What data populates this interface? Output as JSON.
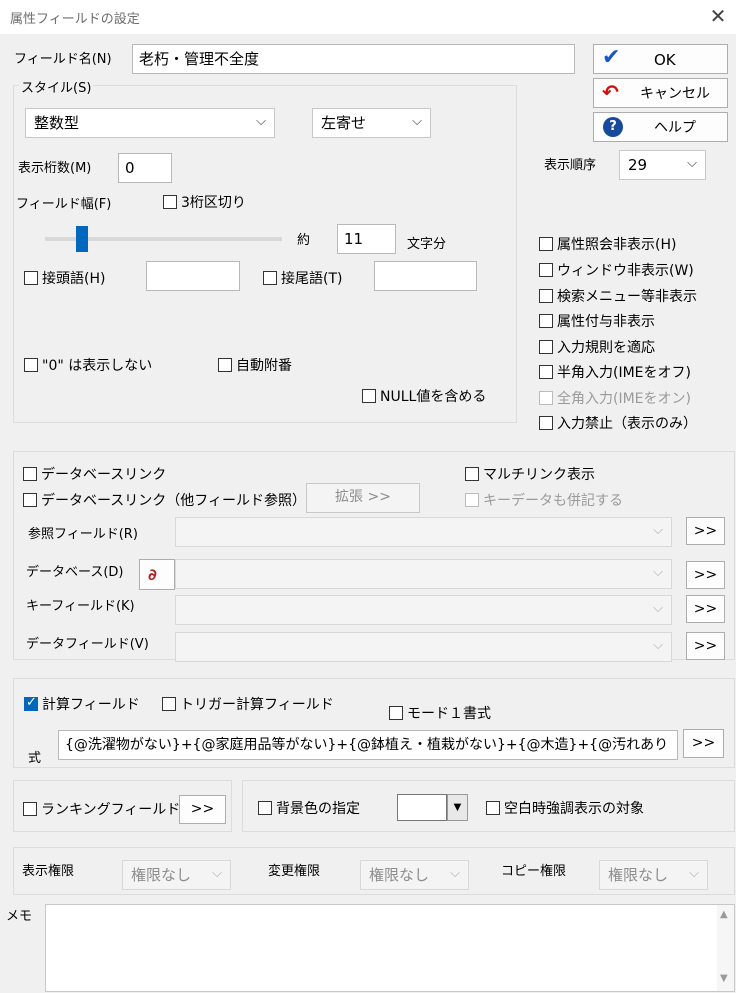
{
  "window": {
    "title": "属性フィールドの設定",
    "close_glyph": "✕"
  },
  "field_name": {
    "label": "フィールド名(N)",
    "value": "老朽・管理不全度"
  },
  "buttons": {
    "ok": "OK",
    "cancel": "キャンセル",
    "help": "ヘルプ"
  },
  "style": {
    "group_label": "スタイル(S)",
    "type_value": "整数型",
    "align_value": "左寄せ",
    "digits_label": "表示桁数(M)",
    "digits_value": "0",
    "width_label": "フィールド幅(F)",
    "thousands_label": "3桁区切り",
    "approx_label": "約",
    "chars_value": "11",
    "chars_unit": "文字分",
    "prefix_label": "接頭語(H)",
    "prefix_value": "",
    "suffix_label": "接尾語(T)",
    "suffix_value": "",
    "hide_zero_label": "\"0\" は表示しない",
    "auto_number_label": "自動附番",
    "include_null_label": "NULL値を含める",
    "slider_level": 0.13
  },
  "order": {
    "label": "表示順序",
    "value": "29"
  },
  "right_checks": [
    {
      "label": "属性照会非表示(H)",
      "checked": false,
      "disabled": false
    },
    {
      "label": "ウィンドウ非表示(W)",
      "checked": false,
      "disabled": false
    },
    {
      "label": "検索メニュー等非表示",
      "checked": false,
      "disabled": false
    },
    {
      "label": "属性付与非表示",
      "checked": false,
      "disabled": false
    },
    {
      "label": "入力規則を適応",
      "checked": false,
      "disabled": false
    },
    {
      "label": "半角入力(IMEをオフ)",
      "checked": false,
      "disabled": false
    },
    {
      "label": "全角入力(IMEをオン)",
      "checked": false,
      "disabled": true
    },
    {
      "label": "入力禁止（表示のみ）",
      "checked": false,
      "disabled": false
    }
  ],
  "db": {
    "db_link_label": "データベースリンク",
    "multi_link_label": "マルチリンク表示",
    "db_link_other_label": "データベースリンク（他フィールド参照）",
    "expand_label": "拡張 >>",
    "key_data_label": "キーデータも併記する",
    "ref_field_label": "参照フィールド(R)",
    "database_label": "データベース(D)",
    "key_field_label": "キーフィールド(K)",
    "data_field_label": "データフィールド(V)",
    "more_label": ">>"
  },
  "calc": {
    "calc_field_label": "計算フィールド",
    "calc_field_checked": true,
    "trigger_label": "トリガー計算フィールド",
    "mode1_label": "モード１書式",
    "formula_label": "式",
    "formula_value": "{@洗濯物がない}+{@家庭用品等がない}+{@鉢植え・植栽がない}+{@木造}+{@汚れあり",
    "more_label": ">>"
  },
  "ranking": {
    "label": "ランキングフィールド",
    "more_label": ">>"
  },
  "background": {
    "label": "背景色の指定",
    "empty_highlight_label": "空白時強調表示の対象",
    "drop_glyph": "▼"
  },
  "permissions": {
    "view_label": "表示権限",
    "view_value": "権限なし",
    "edit_label": "変更権限",
    "edit_value": "権限なし",
    "copy_label": "コピー権限",
    "copy_value": "権限なし"
  },
  "memo": {
    "label": "メモ",
    "value": ""
  },
  "colors": {
    "accent": "#0067c0",
    "background": "#f0f0f0"
  },
  "icons": {
    "ok": "checkmark-icon",
    "cancel": "undo-arrow-icon",
    "help": "question-icon",
    "database": "database-connect-icon"
  }
}
